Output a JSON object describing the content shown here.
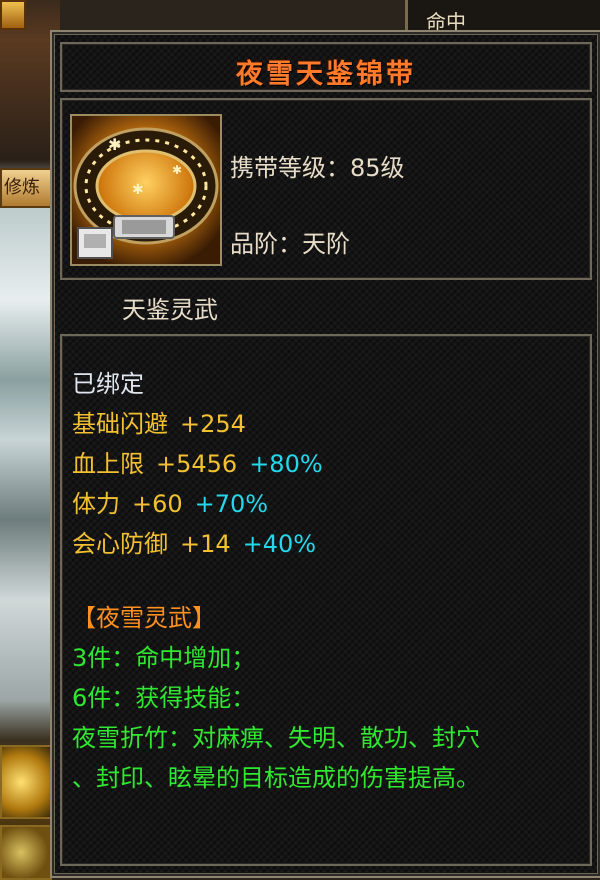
{
  "background": {
    "top_right_label": "命中",
    "left_badge": "修炼"
  },
  "item": {
    "name": "夜雪天鉴锦带",
    "icon": "belt-icon",
    "carry_level": "携带等级：85级",
    "grade": "品阶：天阶",
    "set_name": "天鉴灵武"
  },
  "attributes": {
    "bound": "已绑定",
    "stats": [
      {
        "label": "基础闪避",
        "value": "+254",
        "bonus": ""
      },
      {
        "label": "血上限",
        "value": "+5456",
        "bonus": "+80%"
      },
      {
        "label": "体力",
        "value": "+60",
        "bonus": "+70%"
      },
      {
        "label": "会心防御",
        "value": "+14",
        "bonus": "+40%"
      }
    ],
    "set_title": "【夜雪灵武】",
    "set_effects": [
      "3件：命中增加；",
      "6件：获得技能：",
      "夜雪折竹：对麻痹、失明、散功、封穴",
      "、封印、眩晕的目标造成的伤害提高。"
    ]
  },
  "colors": {
    "title": "#ff7a2a",
    "stat_gold": "#f2c030",
    "bonus_cyan": "#24d8ec",
    "set_orange": "#ff9020",
    "effect_green": "#30e830"
  }
}
